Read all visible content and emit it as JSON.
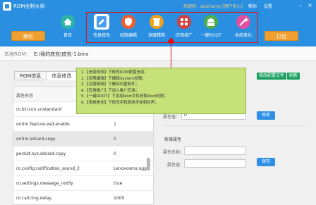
{
  "app": {
    "title": "ROM全制大师"
  },
  "topbar": {
    "welcome": "欢迎你：daichemy [用户中心]",
    "help": "帮助",
    "settings": "设置"
  },
  "side_buttons": {
    "unpack": "解包",
    "pack": "打包"
  },
  "toolbar": [
    {
      "label": "首页",
      "icon": "home-icon",
      "color": "#2cb5a5"
    },
    {
      "label": "信息修改",
      "icon": "edit-document-icon",
      "color": "#4a9ff0"
    },
    {
      "label": "权限编辑",
      "icon": "shield-icon",
      "color": "#f06030"
    },
    {
      "label": "深度精简",
      "icon": "trash-icon",
      "color": "#f0a020"
    },
    {
      "label": "应用推广",
      "icon": "apps-grid-icon",
      "color": "#d04040"
    },
    {
      "label": "一键ROOT",
      "icon": "android-icon",
      "color": "#4cae4c"
    },
    {
      "label": "系统美化",
      "icon": "magic-wand-icon",
      "color": "#e050a0"
    }
  ],
  "path": {
    "label": "本地ROM：",
    "value": "E:\\我的底包\\底包-1.binx"
  },
  "tabs": [
    {
      "label": "ROM信息"
    },
    {
      "label": "信息修改"
    }
  ],
  "table": {
    "header": "属性名称",
    "rows": [
      {
        "key": "ro.bt.icon.unstandard",
        "value": ""
      },
      {
        "key": "ontim.feature.esd.enable",
        "value": "1"
      },
      {
        "key": "ontim.sdcard.copy",
        "value": "0"
      },
      {
        "key": "persist.sys.sdcard.copy",
        "value": "0"
      },
      {
        "key": "ro.config.notification_sound_2",
        "value": "Lenovosms.ogg"
      },
      {
        "key": "ro.settings.message_notify",
        "value": "true"
      },
      {
        "key": "ro.call.ring.delay",
        "value": "1000"
      }
    ]
  },
  "right_buttons": {
    "edit_config": "修改配置文件",
    "refresh": "刷新"
  },
  "edit_form": {
    "value_label": "属性值：",
    "value_input": "0",
    "modify_button": "修改",
    "new_group": "新增属性",
    "name_label": "属性名称：",
    "new_value_label": "属性值：",
    "save_button": "保存"
  },
  "callout": {
    "lines": [
      "1.【信息修改】下修改ROM配置信息；",
      "2.【权限编辑】下编辑System权限；",
      "3.【深度精简】下删除内置软件；",
      "4.【应用推广】下加入推广应用；",
      "5.【一键ROOT】下添加Root文件获取Root权限；",
      "6.【系统美化】下修改手机系统字体和铃声；"
    ]
  }
}
